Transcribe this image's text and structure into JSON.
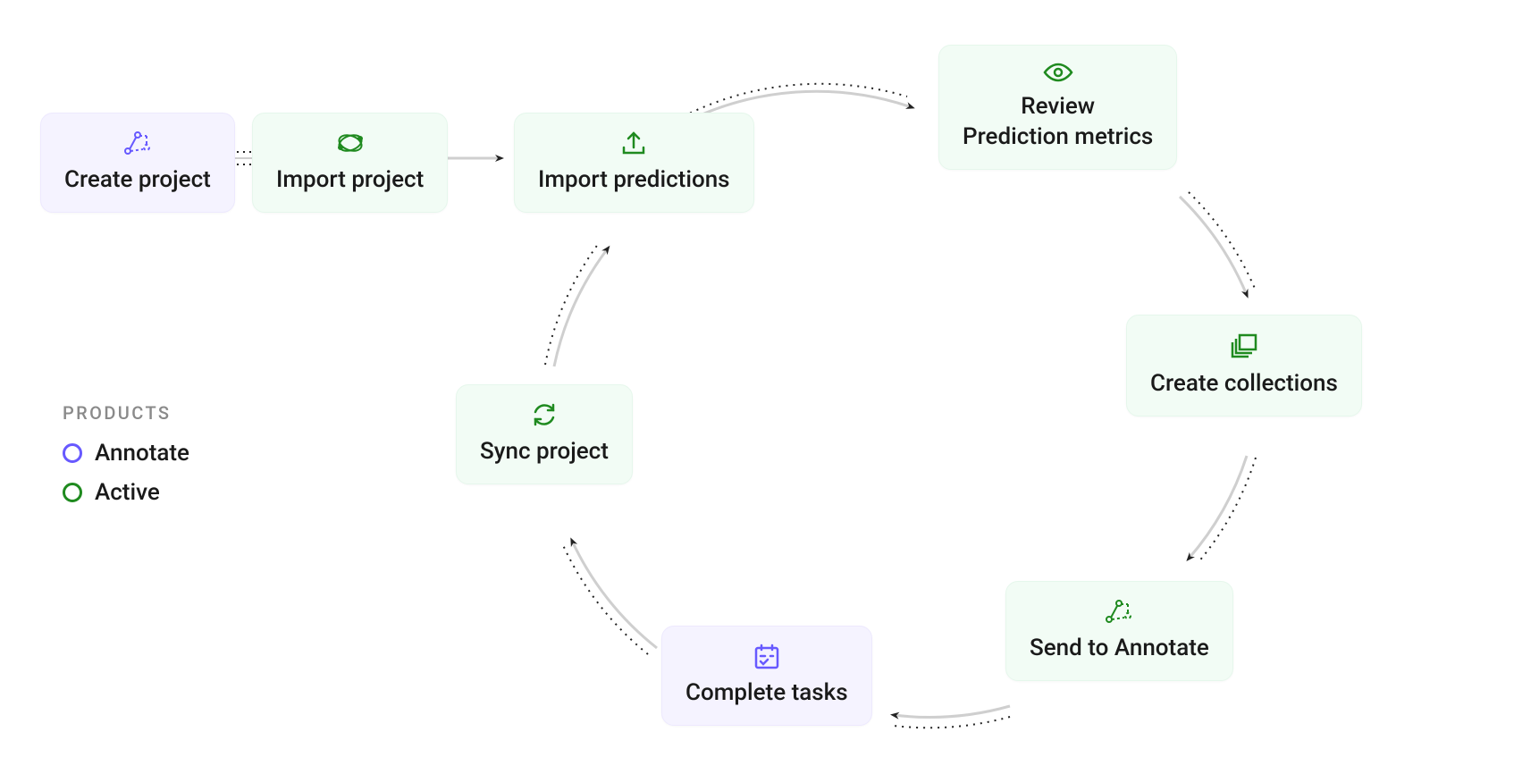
{
  "legend": {
    "title": "PRODUCTS",
    "items": [
      {
        "label": "Annotate",
        "color": "#6759ff"
      },
      {
        "label": "Active",
        "color": "#1f8a1f"
      }
    ]
  },
  "nodes": {
    "create_project": {
      "label": "Create project",
      "icon": "project-create-icon",
      "product": "annotate"
    },
    "import_project": {
      "label": "Import project",
      "icon": "import-project-icon",
      "product": "active"
    },
    "import_predictions": {
      "label": "Import predictions",
      "icon": "upload-icon",
      "product": "active"
    },
    "review_prediction": {
      "label": "Review\nPrediction metrics",
      "icon": "eye-icon",
      "product": "active"
    },
    "create_collections": {
      "label": "Create collections",
      "icon": "collections-icon",
      "product": "active"
    },
    "send_to_annotate": {
      "label": "Send to Annotate",
      "icon": "send-annotate-icon",
      "product": "active"
    },
    "complete_tasks": {
      "label": "Complete tasks",
      "icon": "tasks-icon",
      "product": "annotate"
    },
    "sync_project": {
      "label": "Sync project",
      "icon": "sync-icon",
      "product": "active"
    }
  },
  "colors": {
    "annotate": "#6759ff",
    "active": "#1f8a1f",
    "arrow": "#222222",
    "connector": "#cfcfcf"
  }
}
